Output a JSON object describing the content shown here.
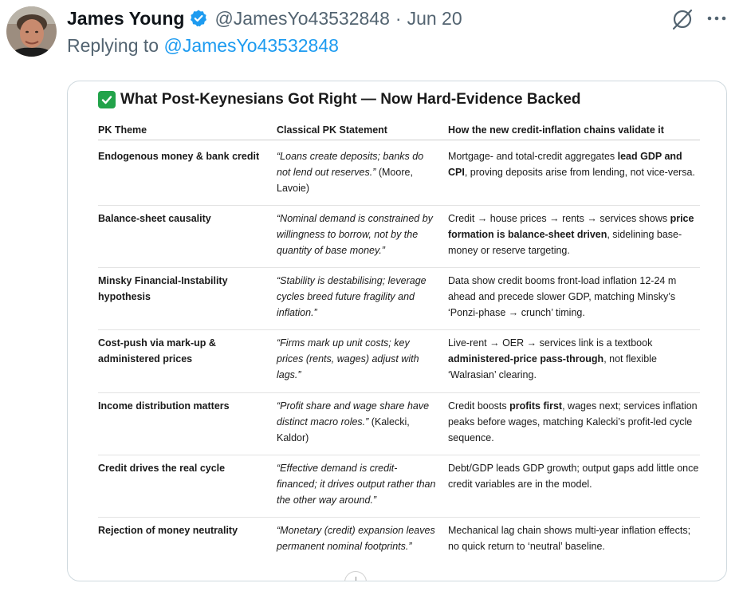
{
  "tweet": {
    "author_name": "James Young",
    "handle": "@JamesYo43532848",
    "separator": "·",
    "date": "Jun 20",
    "reply_prefix": "Replying to",
    "reply_mention": "@JamesYo43532848"
  },
  "icons": {
    "avatar": "avatar-photo",
    "verified": "verified-badge-icon",
    "grok": "grok-icon",
    "more": "more-icon",
    "check": "check-mark-icon"
  },
  "colors": {
    "link": "#1d9bf0",
    "secondary_text": "#536471",
    "check_green": "#22a34a"
  },
  "document": {
    "title": "What Post-Keynesians Got Right — Now Hard-Evidence Backed",
    "headers": [
      "PK Theme",
      "Classical PK Statement",
      "How the new credit-inflation chains validate it"
    ],
    "rows": [
      {
        "theme": "Endogenous money & bank credit",
        "statement_quote": "“Loans create deposits; banks do not lend out reserves.”",
        "statement_source": " (Moore, Lavoie)",
        "validation": [
          {
            "t": "Mortgage- and total-credit aggregates ",
            "b": false
          },
          {
            "t": "lead GDP and CPI",
            "b": true
          },
          {
            "t": ", proving deposits arise from lending, not vice-versa.",
            "b": false
          }
        ]
      },
      {
        "theme": "Balance-sheet causality",
        "statement_quote": "“Nominal demand is constrained by willingness to borrow, not by the quantity of base money.”",
        "statement_source": "",
        "validation": [
          {
            "t": "Credit → house prices → rents → services shows ",
            "b": false
          },
          {
            "t": "price formation is balance-sheet driven",
            "b": true
          },
          {
            "t": ", sidelining base-money or reserve targeting.",
            "b": false
          }
        ]
      },
      {
        "theme": "Minsky Financial-Instability hypothesis",
        "statement_quote": "“Stability is destabilising; leverage cycles breed future fragility and inflation.”",
        "statement_source": "",
        "validation": [
          {
            "t": "Data show credit booms front-load inflation 12-24 m ahead and precede slower GDP, matching Minsky’s ‘Ponzi-phase → crunch’ timing.",
            "b": false
          }
        ]
      },
      {
        "theme": "Cost-push via mark-up & administered prices",
        "statement_quote": "“Firms mark up unit costs; key prices (rents, wages) adjust with lags.”",
        "statement_source": "",
        "validation": [
          {
            "t": "Live-rent → OER → services link is a textbook ",
            "b": false
          },
          {
            "t": "administered-price pass-through",
            "b": true
          },
          {
            "t": ", not flexible ‘Walrasian’ clearing.",
            "b": false
          }
        ]
      },
      {
        "theme": "Income distribution matters",
        "statement_quote": "“Profit share and wage share have distinct macro roles.”",
        "statement_source": " (Kalecki, Kaldor)",
        "validation": [
          {
            "t": "Credit boosts ",
            "b": false
          },
          {
            "t": "profits first",
            "b": true
          },
          {
            "t": ", wages next; services inflation peaks before wages, matching Kalecki’s profit-led cycle sequence.",
            "b": false
          }
        ]
      },
      {
        "theme": "Credit drives the real cycle",
        "statement_quote": "“Effective demand is credit-financed; it drives output rather than the other way around.”",
        "statement_source": "",
        "validation": [
          {
            "t": "Debt/GDP leads GDP growth; output gaps add little once credit variables are in the model.",
            "b": false
          }
        ]
      },
      {
        "theme": "Rejection of money neutrality",
        "statement_quote": "“Monetary (credit) expansion leaves permanent nominal footprints.”",
        "statement_source": "",
        "validation": [
          {
            "t": "Mechanical lag chain shows multi-year inflation effects; no quick return to ‘neutral’ baseline.",
            "b": false
          }
        ]
      }
    ]
  }
}
